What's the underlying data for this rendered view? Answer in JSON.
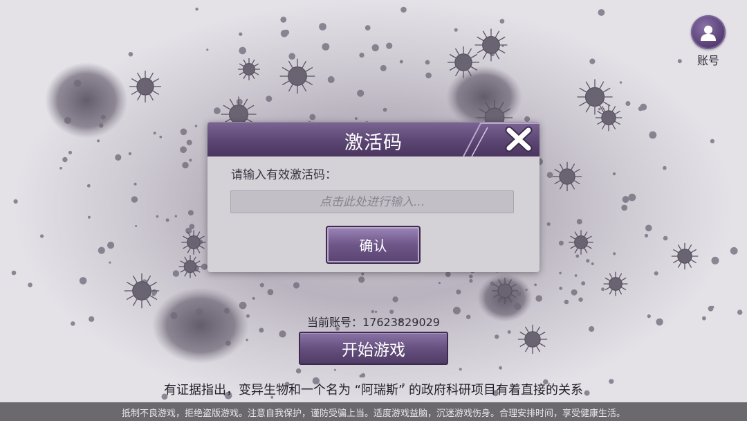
{
  "account": {
    "label": "账号",
    "icon": "user-avatar-icon"
  },
  "dialog": {
    "title": "激活码",
    "prompt": "请输入有效激活码：",
    "input_placeholder": "点击此处进行输入...",
    "input_value": "",
    "confirm_label": "确认",
    "close_icon": "close-x-icon"
  },
  "current_account": "当前账号：17623829029",
  "start_button": "开始游戏",
  "tip": "有证据指出，变异生物和一个名为 “阿瑞斯” 的政府科研项目有着直接的关系",
  "notice": "抵制不良游戏，拒绝盗版游戏。注意自我保护，谨防受骗上当。适度游戏益脑，沉迷游戏伤身。合理安排时间，享受健康生活。",
  "colors": {
    "accent_purple": "#5c4674",
    "button_purple": "#6e5788",
    "dialog_bg": "#d4d1d7"
  }
}
